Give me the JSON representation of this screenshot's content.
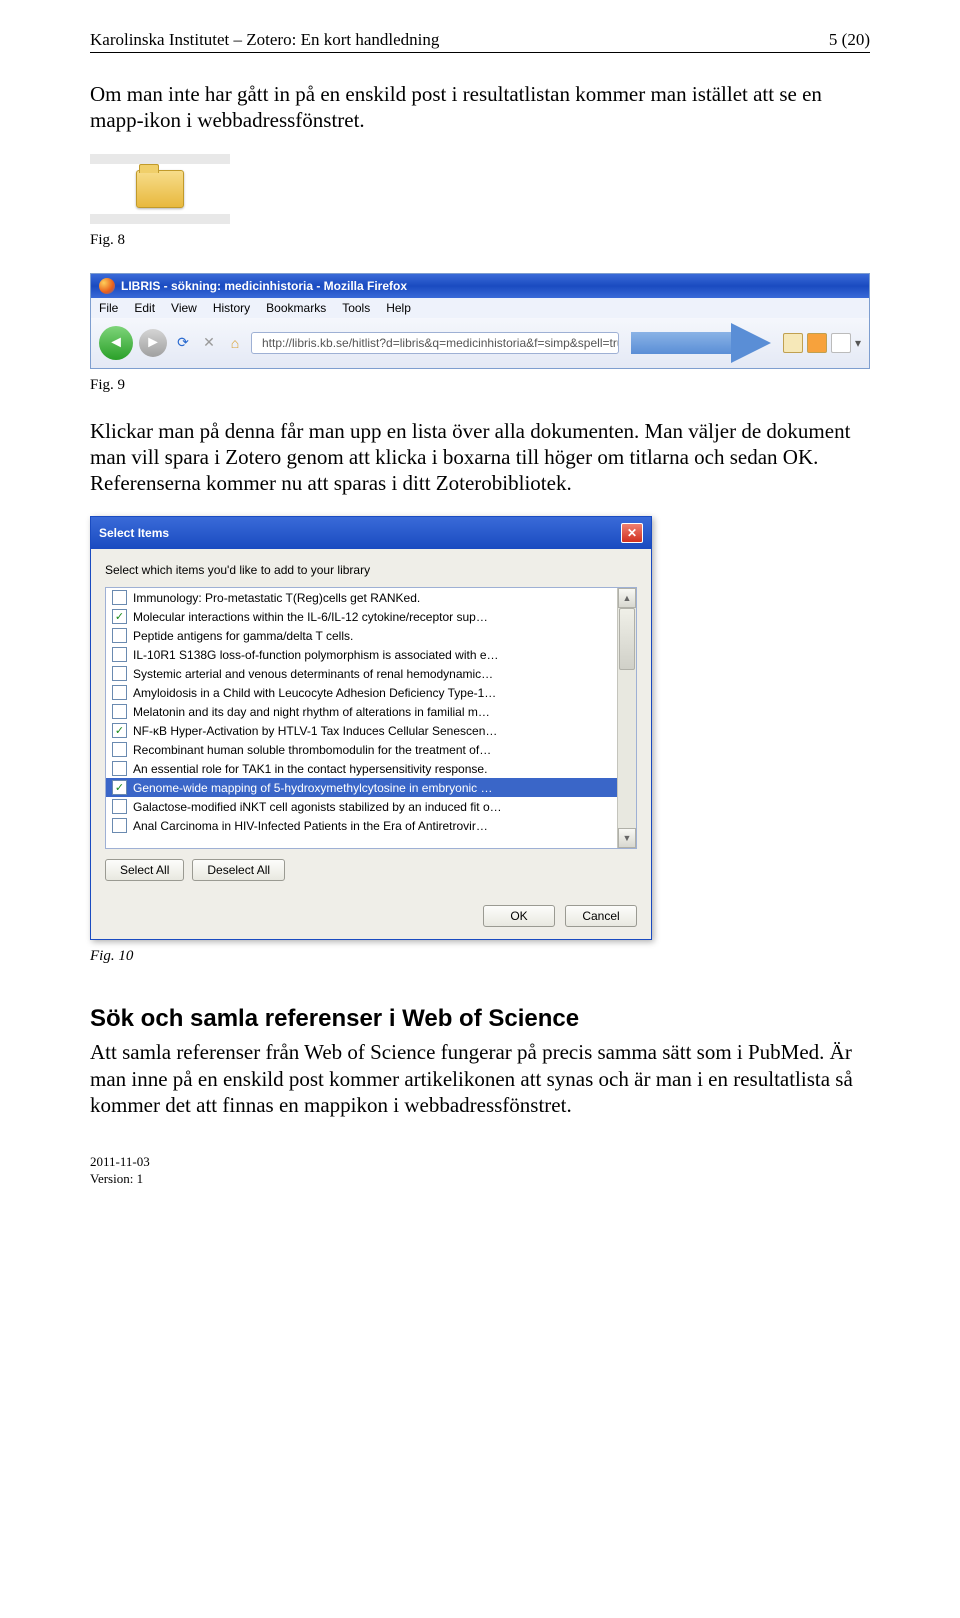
{
  "header": {
    "left": "Karolinska Institutet – Zotero: En kort handledning",
    "right": "5 (20)"
  },
  "para1": "Om man inte har gått in på en enskild post i resultatlistan kommer man istället att se en mapp-ikon i webbadressfönstret.",
  "fig8": "Fig. 8",
  "firefox": {
    "title": "LIBRIS - sökning: medicinhistoria - Mozilla Firefox",
    "menu": [
      "File",
      "Edit",
      "View",
      "History",
      "Bookmarks",
      "Tools",
      "Help"
    ],
    "url": "http://libris.kb.se/hitlist?d=libris&q=medicinhistoria&f=simp&spell=true&his"
  },
  "fig9": "Fig. 9",
  "para2": "Klickar man på denna får man upp en lista över alla dokumenten. Man väljer de dokument man vill spara i Zotero genom att klicka i boxarna till höger om titlarna och sedan OK. Referenserna kommer nu att sparas i ditt Zoterobibliotek.",
  "dialog": {
    "title": "Select Items",
    "instruction": "Select which items you'd like to add to your library",
    "items": [
      {
        "checked": false,
        "label": "Immunology: Pro-metastatic T(Reg)cells get RANKed."
      },
      {
        "checked": true,
        "label": "Molecular interactions within the IL-6/IL-12 cytokine/receptor sup…"
      },
      {
        "checked": false,
        "label": "Peptide antigens for gamma/delta T cells."
      },
      {
        "checked": false,
        "label": "IL-10R1 S138G loss-of-function polymorphism is associated with e…"
      },
      {
        "checked": false,
        "label": "Systemic arterial and venous determinants of renal hemodynamic…"
      },
      {
        "checked": false,
        "label": "Amyloidosis in a Child with Leucocyte Adhesion Deficiency Type-1…"
      },
      {
        "checked": false,
        "label": "Melatonin and its day and night rhythm of alterations in familial m…"
      },
      {
        "checked": true,
        "label": "NF-κB Hyper-Activation by HTLV-1 Tax Induces Cellular Senescen…"
      },
      {
        "checked": false,
        "label": "Recombinant human soluble thrombomodulin for the treatment of…"
      },
      {
        "checked": false,
        "label": "An essential role for TAK1 in the contact hypersensitivity response."
      },
      {
        "checked": true,
        "label": "Genome-wide mapping of 5-hydroxymethylcytosine in embryonic …",
        "selected": true
      },
      {
        "checked": false,
        "label": "Galactose-modified iNKT cell agonists stabilized by an induced fit o…"
      },
      {
        "checked": false,
        "label": "Anal Carcinoma in HIV-Infected Patients in the Era of Antiretrovir…"
      }
    ],
    "select_all": "Select All",
    "deselect_all": "Deselect All",
    "ok": "OK",
    "cancel": "Cancel"
  },
  "fig10": "Fig. 10",
  "section_heading": "Sök och samla referenser i Web of Science",
  "para3": "Att samla referenser från Web of Science fungerar på precis samma sätt som i PubMed. Är man inne på en enskild post kommer artikelikonen att synas och är man i en resultatlista så kommer det att finnas en mappikon i webbadressfönstret.",
  "footer": {
    "date": "2011-11-03",
    "version": "Version: 1"
  }
}
